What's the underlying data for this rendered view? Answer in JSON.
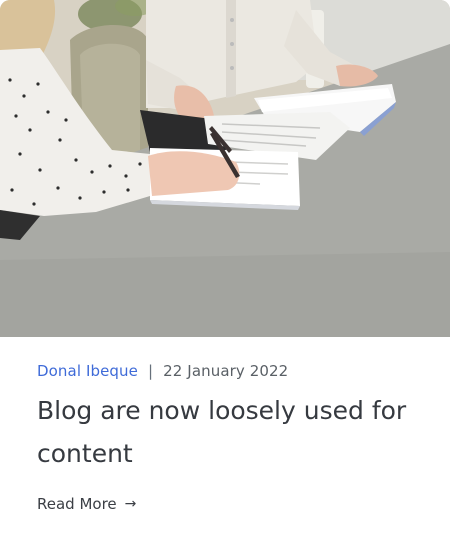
{
  "card": {
    "image_alt": "two people reviewing documents at a desk",
    "author": "Donal Ibeque",
    "separator": "|",
    "date": "22 January 2022",
    "title": "Blog are now loosely used for content",
    "read_more": "Read More",
    "arrow_icon": "→"
  },
  "colors": {
    "author": "#3f6bd8",
    "title": "#363a40",
    "desk": "#a9aaa5"
  }
}
